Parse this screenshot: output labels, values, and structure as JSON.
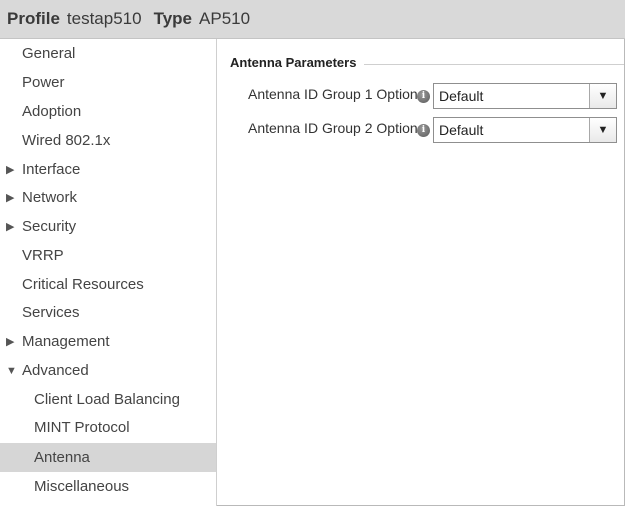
{
  "header": {
    "profile_label": "Profile",
    "profile_value": "testap510",
    "type_label": "Type",
    "type_value": "AP510"
  },
  "sidebar": {
    "items": [
      {
        "label": "General",
        "expandable": false,
        "sub": false,
        "selected": false
      },
      {
        "label": "Power",
        "expandable": false,
        "sub": false,
        "selected": false
      },
      {
        "label": "Adoption",
        "expandable": false,
        "sub": false,
        "selected": false
      },
      {
        "label": "Wired 802.1x",
        "expandable": false,
        "sub": false,
        "selected": false
      },
      {
        "label": "Interface",
        "expandable": true,
        "expanded": false,
        "sub": false,
        "selected": false
      },
      {
        "label": "Network",
        "expandable": true,
        "expanded": false,
        "sub": false,
        "selected": false
      },
      {
        "label": "Security",
        "expandable": true,
        "expanded": false,
        "sub": false,
        "selected": false
      },
      {
        "label": "VRRP",
        "expandable": false,
        "sub": false,
        "selected": false
      },
      {
        "label": "Critical Resources",
        "expandable": false,
        "sub": false,
        "selected": false
      },
      {
        "label": "Services",
        "expandable": false,
        "sub": false,
        "selected": false
      },
      {
        "label": "Management",
        "expandable": true,
        "expanded": false,
        "sub": false,
        "selected": false
      },
      {
        "label": "Advanced",
        "expandable": true,
        "expanded": true,
        "sub": false,
        "selected": false
      },
      {
        "label": "Client Load Balancing",
        "expandable": false,
        "sub": true,
        "selected": false
      },
      {
        "label": "MINT Protocol",
        "expandable": false,
        "sub": true,
        "selected": false
      },
      {
        "label": "Antenna",
        "expandable": false,
        "sub": true,
        "selected": true
      },
      {
        "label": "Miscellaneous",
        "expandable": false,
        "sub": true,
        "selected": false
      }
    ]
  },
  "content": {
    "section_title": "Antenna Parameters",
    "fields": [
      {
        "label": "Antenna ID Group 1 Option",
        "value": "Default"
      },
      {
        "label": "Antenna ID Group 2 Option",
        "value": "Default"
      }
    ]
  },
  "icons": {
    "collapsed": "triangle-right-icon",
    "expanded": "triangle-down-icon",
    "info": "info-icon",
    "dropdown": "chevron-down-icon"
  }
}
